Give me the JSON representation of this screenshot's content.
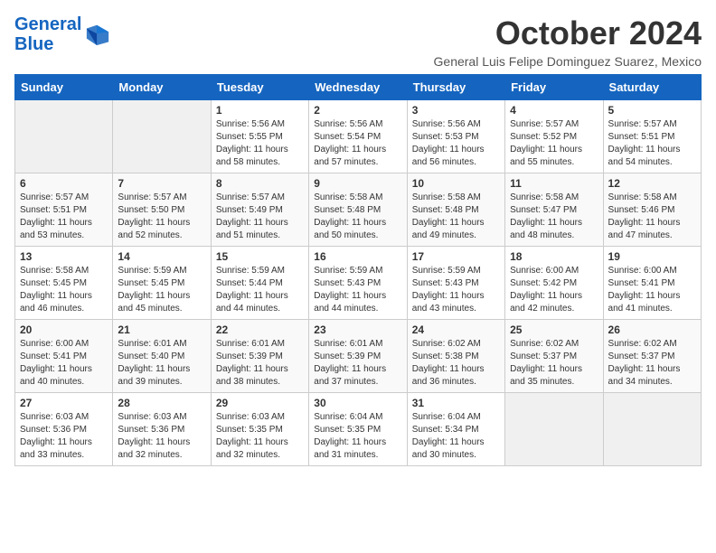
{
  "header": {
    "logo_line1": "General",
    "logo_line2": "Blue",
    "month": "October 2024",
    "subtitle": "General Luis Felipe Dominguez Suarez, Mexico"
  },
  "days_of_week": [
    "Sunday",
    "Monday",
    "Tuesday",
    "Wednesday",
    "Thursday",
    "Friday",
    "Saturday"
  ],
  "weeks": [
    [
      {
        "day": "",
        "data": ""
      },
      {
        "day": "",
        "data": ""
      },
      {
        "day": "1",
        "sunrise": "5:56 AM",
        "sunset": "5:55 PM",
        "daylight": "11 hours and 58 minutes."
      },
      {
        "day": "2",
        "sunrise": "5:56 AM",
        "sunset": "5:54 PM",
        "daylight": "11 hours and 57 minutes."
      },
      {
        "day": "3",
        "sunrise": "5:56 AM",
        "sunset": "5:53 PM",
        "daylight": "11 hours and 56 minutes."
      },
      {
        "day": "4",
        "sunrise": "5:57 AM",
        "sunset": "5:52 PM",
        "daylight": "11 hours and 55 minutes."
      },
      {
        "day": "5",
        "sunrise": "5:57 AM",
        "sunset": "5:51 PM",
        "daylight": "11 hours and 54 minutes."
      }
    ],
    [
      {
        "day": "6",
        "sunrise": "5:57 AM",
        "sunset": "5:51 PM",
        "daylight": "11 hours and 53 minutes."
      },
      {
        "day": "7",
        "sunrise": "5:57 AM",
        "sunset": "5:50 PM",
        "daylight": "11 hours and 52 minutes."
      },
      {
        "day": "8",
        "sunrise": "5:57 AM",
        "sunset": "5:49 PM",
        "daylight": "11 hours and 51 minutes."
      },
      {
        "day": "9",
        "sunrise": "5:58 AM",
        "sunset": "5:48 PM",
        "daylight": "11 hours and 50 minutes."
      },
      {
        "day": "10",
        "sunrise": "5:58 AM",
        "sunset": "5:48 PM",
        "daylight": "11 hours and 49 minutes."
      },
      {
        "day": "11",
        "sunrise": "5:58 AM",
        "sunset": "5:47 PM",
        "daylight": "11 hours and 48 minutes."
      },
      {
        "day": "12",
        "sunrise": "5:58 AM",
        "sunset": "5:46 PM",
        "daylight": "11 hours and 47 minutes."
      }
    ],
    [
      {
        "day": "13",
        "sunrise": "5:58 AM",
        "sunset": "5:45 PM",
        "daylight": "11 hours and 46 minutes."
      },
      {
        "day": "14",
        "sunrise": "5:59 AM",
        "sunset": "5:45 PM",
        "daylight": "11 hours and 45 minutes."
      },
      {
        "day": "15",
        "sunrise": "5:59 AM",
        "sunset": "5:44 PM",
        "daylight": "11 hours and 44 minutes."
      },
      {
        "day": "16",
        "sunrise": "5:59 AM",
        "sunset": "5:43 PM",
        "daylight": "11 hours and 44 minutes."
      },
      {
        "day": "17",
        "sunrise": "5:59 AM",
        "sunset": "5:43 PM",
        "daylight": "11 hours and 43 minutes."
      },
      {
        "day": "18",
        "sunrise": "6:00 AM",
        "sunset": "5:42 PM",
        "daylight": "11 hours and 42 minutes."
      },
      {
        "day": "19",
        "sunrise": "6:00 AM",
        "sunset": "5:41 PM",
        "daylight": "11 hours and 41 minutes."
      }
    ],
    [
      {
        "day": "20",
        "sunrise": "6:00 AM",
        "sunset": "5:41 PM",
        "daylight": "11 hours and 40 minutes."
      },
      {
        "day": "21",
        "sunrise": "6:01 AM",
        "sunset": "5:40 PM",
        "daylight": "11 hours and 39 minutes."
      },
      {
        "day": "22",
        "sunrise": "6:01 AM",
        "sunset": "5:39 PM",
        "daylight": "11 hours and 38 minutes."
      },
      {
        "day": "23",
        "sunrise": "6:01 AM",
        "sunset": "5:39 PM",
        "daylight": "11 hours and 37 minutes."
      },
      {
        "day": "24",
        "sunrise": "6:02 AM",
        "sunset": "5:38 PM",
        "daylight": "11 hours and 36 minutes."
      },
      {
        "day": "25",
        "sunrise": "6:02 AM",
        "sunset": "5:37 PM",
        "daylight": "11 hours and 35 minutes."
      },
      {
        "day": "26",
        "sunrise": "6:02 AM",
        "sunset": "5:37 PM",
        "daylight": "11 hours and 34 minutes."
      }
    ],
    [
      {
        "day": "27",
        "sunrise": "6:03 AM",
        "sunset": "5:36 PM",
        "daylight": "11 hours and 33 minutes."
      },
      {
        "day": "28",
        "sunrise": "6:03 AM",
        "sunset": "5:36 PM",
        "daylight": "11 hours and 32 minutes."
      },
      {
        "day": "29",
        "sunrise": "6:03 AM",
        "sunset": "5:35 PM",
        "daylight": "11 hours and 32 minutes."
      },
      {
        "day": "30",
        "sunrise": "6:04 AM",
        "sunset": "5:35 PM",
        "daylight": "11 hours and 31 minutes."
      },
      {
        "day": "31",
        "sunrise": "6:04 AM",
        "sunset": "5:34 PM",
        "daylight": "11 hours and 30 minutes."
      },
      {
        "day": "",
        "data": ""
      },
      {
        "day": "",
        "data": ""
      }
    ]
  ],
  "labels": {
    "sunrise": "Sunrise:",
    "sunset": "Sunset:",
    "daylight": "Daylight:"
  }
}
